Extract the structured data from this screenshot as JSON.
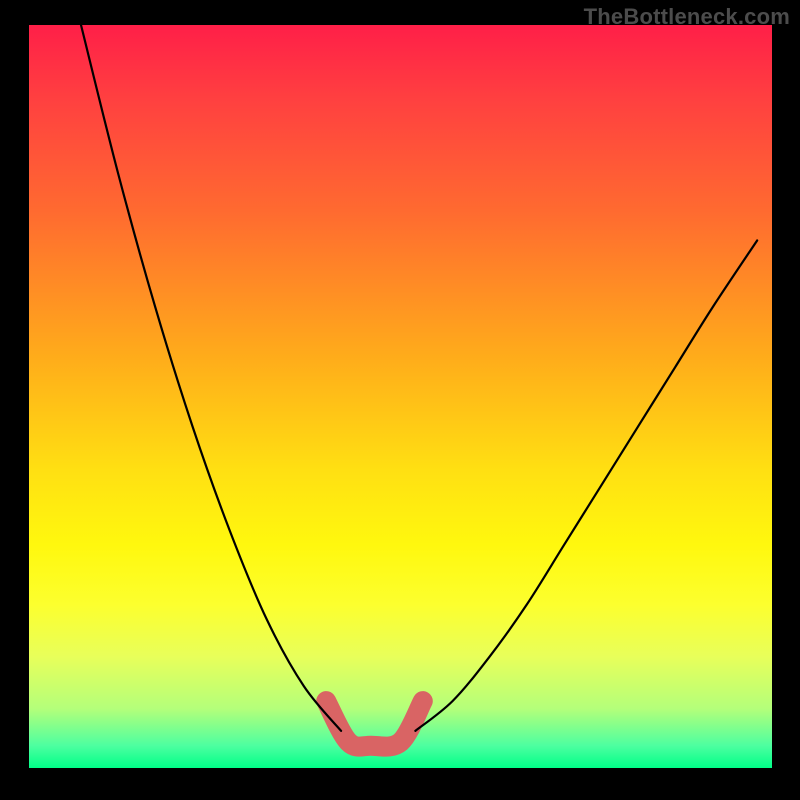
{
  "watermark": "TheBottleneck.com",
  "chart_data": {
    "type": "line",
    "title": "",
    "xlabel": "",
    "ylabel": "",
    "xlim": [
      0,
      100
    ],
    "ylim": [
      0,
      100
    ],
    "grid": false,
    "legend": false,
    "curve_left": {
      "x": [
        7,
        12,
        17,
        22,
        27,
        32,
        37,
        42
      ],
      "y": [
        100,
        80,
        62,
        46,
        32,
        20,
        11,
        5
      ]
    },
    "curve_right": {
      "x": [
        52,
        57,
        62,
        67,
        72,
        77,
        82,
        87,
        92,
        98
      ],
      "y": [
        5,
        9,
        15,
        22,
        30,
        38,
        46,
        54,
        62,
        71
      ]
    },
    "valley_points": {
      "x": [
        40,
        43,
        46,
        50,
        53
      ],
      "y": [
        9,
        3.5,
        3,
        3.5,
        9
      ]
    },
    "colors": {
      "gradient_top": "#ff1f48",
      "gradient_bottom": "#00ff88",
      "curve": "#000000",
      "valley_highlight": "#d96464",
      "frame_background": "#000000"
    }
  }
}
